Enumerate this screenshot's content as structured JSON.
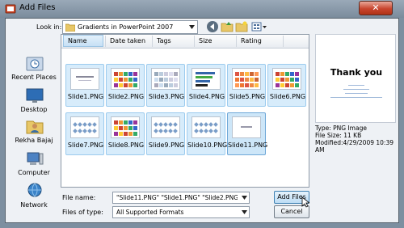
{
  "window": {
    "title": "Add Files"
  },
  "toolbar": {
    "lookin_label": "Look in:",
    "lookin_value": "Gradients in PowerPoint 2007"
  },
  "places": [
    {
      "label": "Recent Places",
      "icon": "recent-places-icon"
    },
    {
      "label": "Desktop",
      "icon": "desktop-icon"
    },
    {
      "label": "Rekha Bajaj",
      "icon": "user-folder-icon"
    },
    {
      "label": "Computer",
      "icon": "computer-icon"
    },
    {
      "label": "Network",
      "icon": "network-icon"
    }
  ],
  "columns": [
    "Name",
    "Date taken",
    "Tags",
    "Size",
    "Rating"
  ],
  "files": [
    {
      "name": "Slide1.PNG",
      "style": "title"
    },
    {
      "name": "Slide2.PNG",
      "style": "grid"
    },
    {
      "name": "Slide3.PNG",
      "style": "grid-light"
    },
    {
      "name": "Slide4.PNG",
      "style": "bars"
    },
    {
      "name": "Slide5.PNG",
      "style": "grid-warm"
    },
    {
      "name": "Slide6.PNG",
      "style": "grid"
    },
    {
      "name": "Slide7.PNG",
      "style": "stars"
    },
    {
      "name": "Slide8.PNG",
      "style": "grid"
    },
    {
      "name": "Slide9.PNG",
      "style": "stars"
    },
    {
      "name": "Slide10.PNG",
      "style": "stars"
    },
    {
      "name": "Slide11.PNG",
      "style": "blank"
    }
  ],
  "preview": {
    "title": "Thank you"
  },
  "file_info": {
    "type": "Type: PNG Image",
    "size": "File Size: 11 KB",
    "modified": "Modified:4/29/2009 10:39 AM"
  },
  "form": {
    "filename_label": "File name:",
    "filename_value": "\"Slide11.PNG\" \"Slide1.PNG\" \"Slide2.PNG\" \"Slide",
    "filetype_label": "Files of type:",
    "filetype_value": "All Supported Formats"
  },
  "buttons": {
    "add": "Add Files",
    "cancel": "Cancel"
  }
}
